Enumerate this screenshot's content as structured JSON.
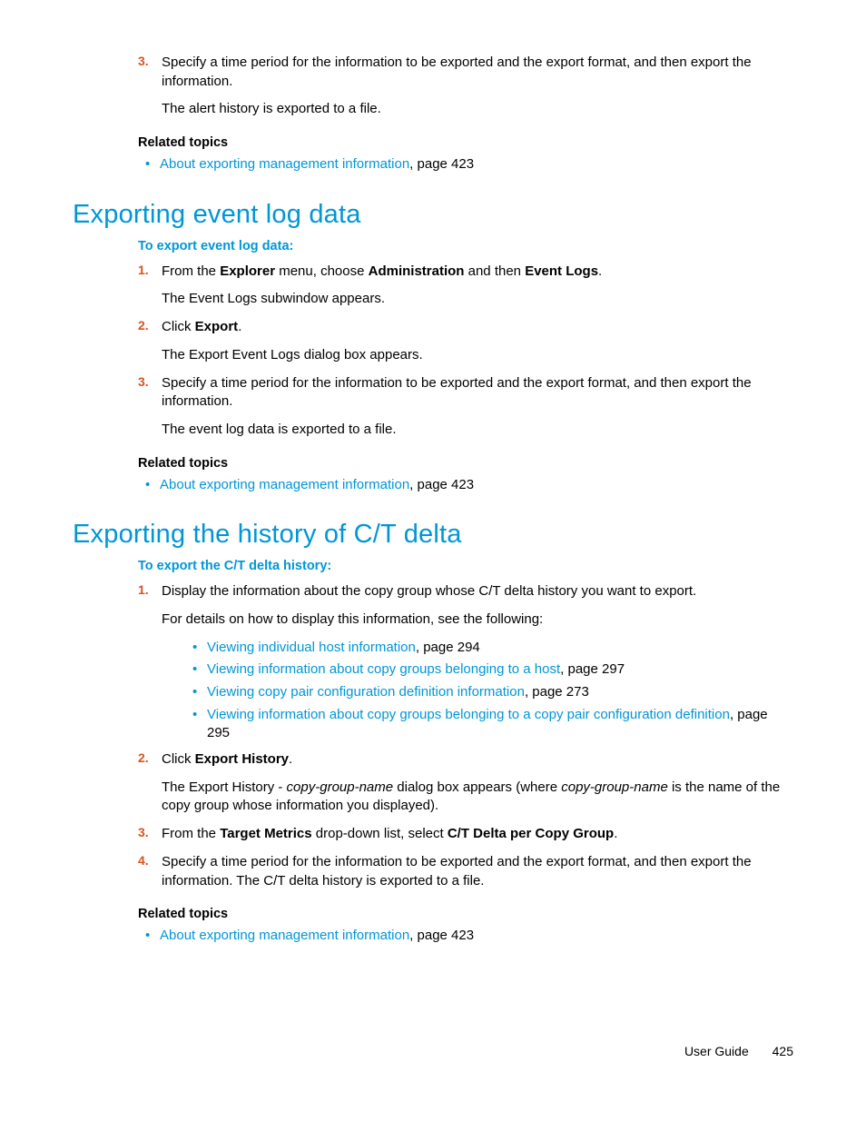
{
  "top_section": {
    "step3_num": "3.",
    "step3_text_a": "Specify a time period for the information to be exported and the export format, and then export the information.",
    "step3_text_b": "The alert history is exported to a file.",
    "related_heading": "Related topics",
    "related_link": "About exporting management information",
    "related_page": ", page 423"
  },
  "section1": {
    "title": "Exporting event log data",
    "procedure": "To export event log data:",
    "step1_num": "1.",
    "step1_a": "From the ",
    "step1_b": "Explorer",
    "step1_c": " menu, choose ",
    "step1_d": "Administration",
    "step1_e": " and then ",
    "step1_f": "Event Logs",
    "step1_g": ".",
    "step1_sub": "The Event Logs subwindow appears.",
    "step2_num": "2.",
    "step2_a": "Click ",
    "step2_b": "Export",
    "step2_c": ".",
    "step2_sub": "The Export Event Logs dialog box appears.",
    "step3_num": "3.",
    "step3_a": "Specify a time period for the information to be exported and the export format, and then export the information.",
    "step3_sub": "The event log data is exported to a file.",
    "related_heading": "Related topics",
    "related_link": "About exporting management information",
    "related_page": ", page 423"
  },
  "section2": {
    "title": "Exporting the history of C/T delta",
    "procedure": "To export the C/T delta history:",
    "step1_num": "1.",
    "step1_a": "Display the information about the copy group whose C/T delta history you want to export.",
    "step1_sub": "For details on how to display this information, see the following:",
    "link1": "Viewing individual host information",
    "link1_page": ", page 294",
    "link2": "Viewing information about copy groups belonging to a host",
    "link2_page": ", page 297",
    "link3": "Viewing copy pair configuration definition information",
    "link3_page": ", page 273",
    "link4": "Viewing information about copy groups belonging to a copy pair configuration definition",
    "link4_page": ", page 295",
    "step2_num": "2.",
    "step2_a": "Click ",
    "step2_b": "Export History",
    "step2_c": ".",
    "step2_sub_a": "The Export History - ",
    "step2_sub_b": "copy-group-name",
    "step2_sub_c": " dialog box appears (where ",
    "step2_sub_d": "copy-group-name",
    "step2_sub_e": " is the name of the copy group whose information you displayed).",
    "step3_num": "3.",
    "step3_a": "From the ",
    "step3_b": "Target Metrics",
    "step3_c": " drop-down list, select ",
    "step3_d": "C/T Delta per Copy Group",
    "step3_e": ".",
    "step4_num": "4.",
    "step4_a": "Specify a time period for the information to be exported and the export format, and then export the information. The C/T delta history is exported to a file.",
    "related_heading": "Related topics",
    "related_link": "About exporting management information",
    "related_page": ", page 423"
  },
  "footer": {
    "label": "User Guide",
    "page": "425"
  }
}
